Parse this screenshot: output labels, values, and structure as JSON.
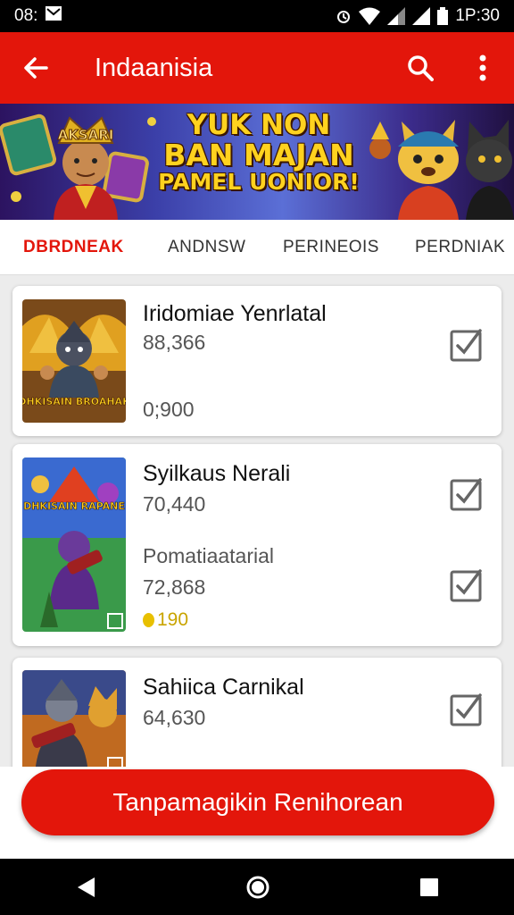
{
  "status_bar": {
    "time_left": "08:",
    "time_right": "1P:30"
  },
  "app_bar": {
    "title": "Indaanisia",
    "back_icon": "arrow-back-icon",
    "search_icon": "search-icon",
    "menu_icon": "more-vert-icon"
  },
  "banner": {
    "line1": "YUK NON",
    "line2": "BAN MAJAN",
    "line3": "PAMEL UONIOR!",
    "logo_text": "AKSARI"
  },
  "tabs": [
    {
      "label": "DBRDNEAK",
      "active": true
    },
    {
      "label": "ANDNSW",
      "active": false
    },
    {
      "label": "PERINEOIS",
      "active": false
    },
    {
      "label": "PERDNIAK",
      "active": false
    }
  ],
  "games": [
    {
      "name": "Iridomiae Yenrlatal",
      "value": "88,366",
      "sub_value": "0;900",
      "thumb_text": "DHKISAIN BROAHAK"
    },
    {
      "name": "Syilkaus Nerali",
      "value": "70,440",
      "sub_label": "Pomatiaatarial",
      "sub_value": "72,868",
      "coins": "190",
      "thumb_text": "DHKISAIN RAPANE"
    },
    {
      "name": "Sahiica Carnikal",
      "value": "64,630"
    }
  ],
  "cta": {
    "label": "Tanpamagikin Renihorean"
  },
  "colors": {
    "primary": "#e3160b",
    "accent": "#ffd21f"
  }
}
